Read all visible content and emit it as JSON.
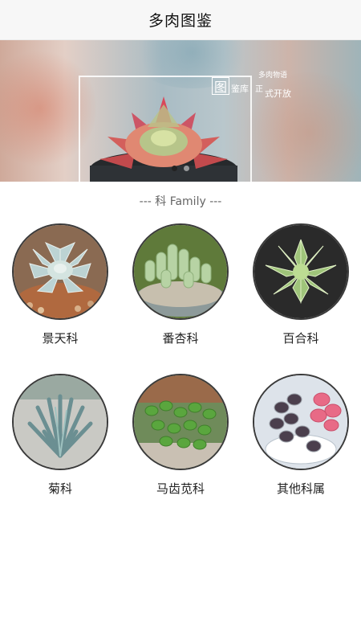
{
  "header": {
    "title": "多肉图鉴"
  },
  "banner": {
    "text_small": "多肉物语",
    "text_char": "图",
    "text_a": "鉴库",
    "text_b": "正",
    "text_c": "式开放",
    "dots": [
      {
        "active": true
      },
      {
        "active": false
      }
    ]
  },
  "section": {
    "title": "--- 科 Family ---"
  },
  "families": [
    {
      "label": "景天科",
      "icon": "echeveria-photo",
      "bg": "#8a6a52"
    },
    {
      "label": "番杏科",
      "icon": "conophytum-photo",
      "bg": "#5f7a3a"
    },
    {
      "label": "百合科",
      "icon": "haworthia-photo",
      "bg": "#2a2a2a"
    },
    {
      "label": "菊科",
      "icon": "senecio-photo",
      "bg": "#c9c9c4"
    },
    {
      "label": "马齿苋科",
      "icon": "portulaca-photo",
      "bg": "#6f8b5a"
    },
    {
      "label": "其他科属",
      "icon": "peperomia-photo",
      "bg": "#dde3ea"
    }
  ]
}
